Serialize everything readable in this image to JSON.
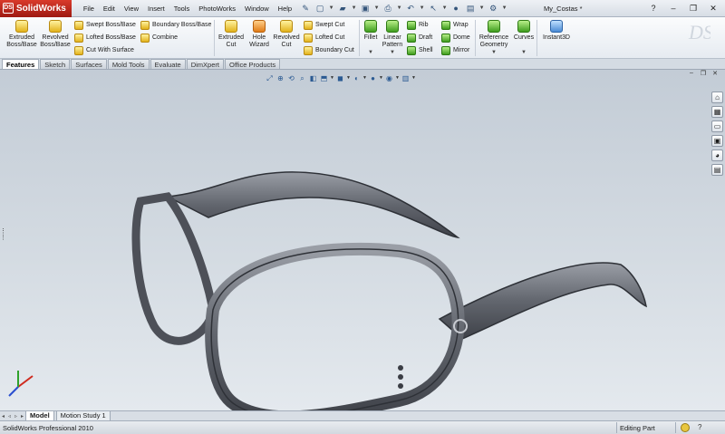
{
  "app": {
    "name": "SolidWorks",
    "logo_badge": "DS"
  },
  "menu": [
    "File",
    "Edit",
    "View",
    "Insert",
    "Tools",
    "PhotoWorks",
    "Window",
    "Help"
  ],
  "document_title": "My_Costas *",
  "command_manager": {
    "extruded_boss": "Extruded Boss/Base",
    "revolved_boss": "Revolved Boss/Base",
    "swept_boss": "Swept Boss/Base",
    "lofted_boss": "Lofted Boss/Base",
    "cut_with_surface": "Cut With Surface",
    "boundary_boss": "Boundary Boss/Base",
    "combine": "Combine",
    "extruded_cut": "Extruded Cut",
    "hole_wizard": "Hole Wizard",
    "revolved_cut": "Revolved Cut",
    "swept_cut": "Swept Cut",
    "lofted_cut": "Lofted Cut",
    "boundary_cut": "Boundary Cut",
    "fillet": "Fillet",
    "linear_pattern": "Linear Pattern",
    "rib": "Rib",
    "draft": "Draft",
    "shell": "Shell",
    "wrap": "Wrap",
    "dome": "Dome",
    "mirror": "Mirror",
    "reference_geometry": "Reference Geometry",
    "curves": "Curves",
    "instant3d": "Instant3D"
  },
  "tabs": [
    "Features",
    "Sketch",
    "Surfaces",
    "Mold Tools",
    "Evaluate",
    "DimXpert",
    "Office Products"
  ],
  "active_tab": "Features",
  "model_tabs": [
    "Model",
    "Motion Study 1"
  ],
  "status": {
    "left": "SolidWorks Professional 2010",
    "mode": "Editing Part",
    "help": "?"
  },
  "colors": {
    "brand_red": "#c0281c",
    "frame": "#5b5e66",
    "viewport_top": "#c3ccd6",
    "viewport_bottom": "#e4e9ee"
  },
  "icons": {
    "triad": "axis-triad-icon",
    "taskpane": [
      "home-icon",
      "library-icon",
      "folder-icon",
      "view-palette-icon",
      "appearance-icon",
      "custom-props-icon"
    ]
  }
}
